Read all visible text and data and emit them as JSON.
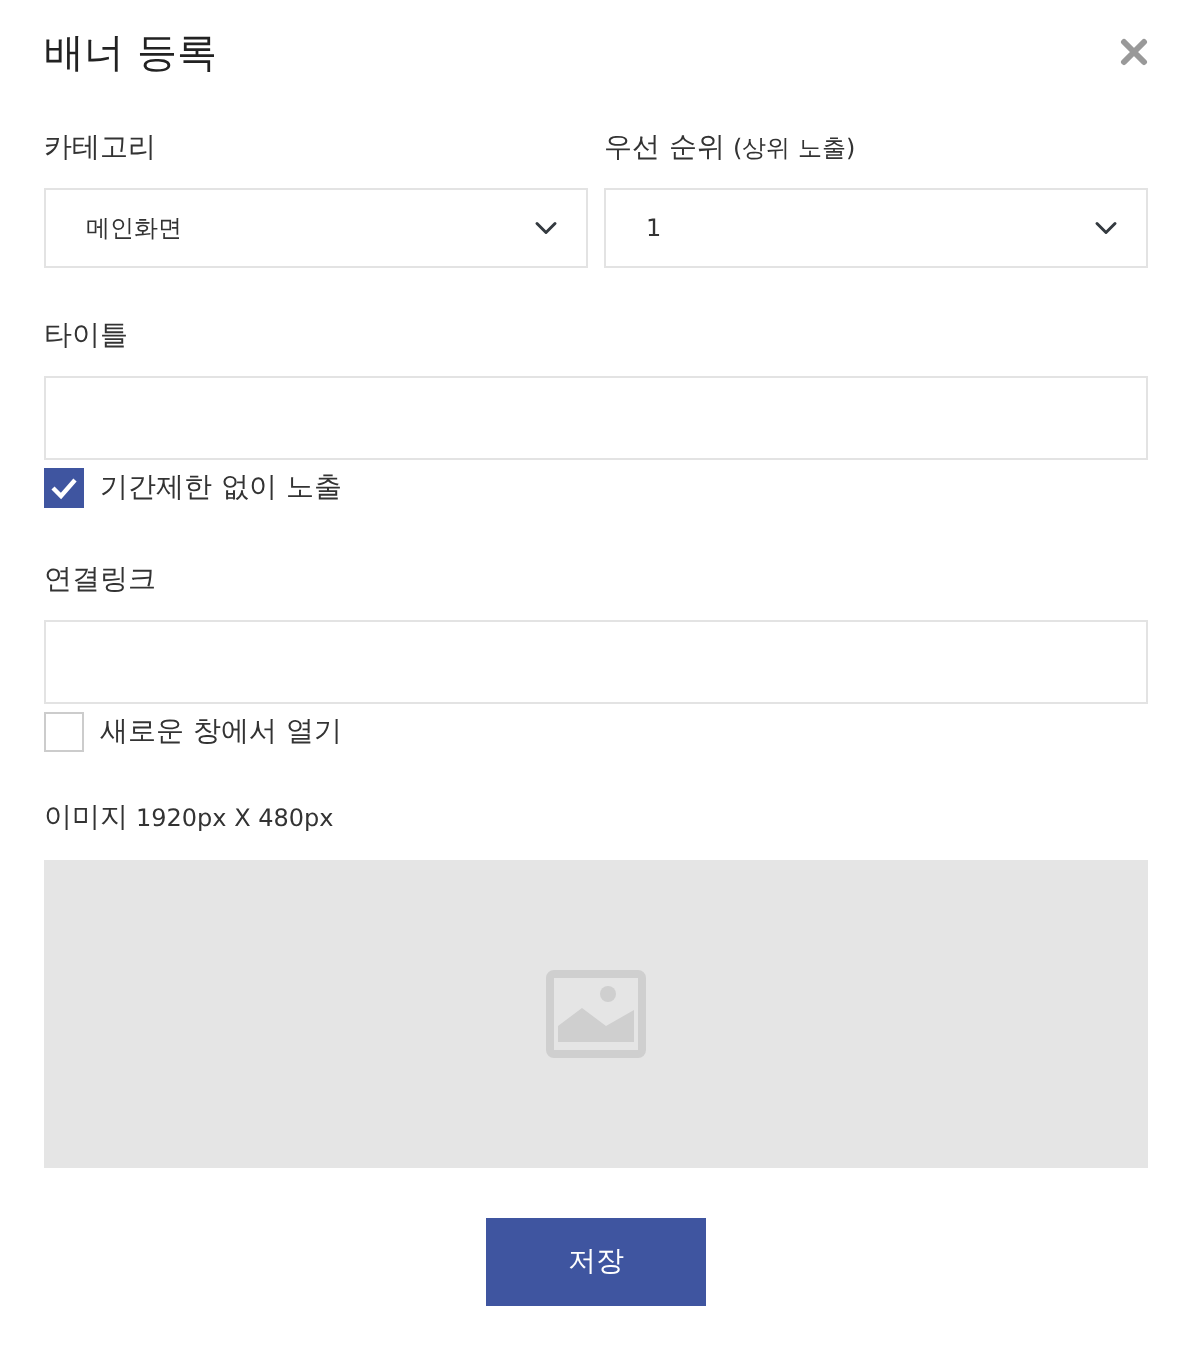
{
  "dialog": {
    "title": "배너 등록"
  },
  "category": {
    "label": "카테고리",
    "value": "메인화면"
  },
  "priority": {
    "label": "우선 순위",
    "note": "(상위 노출)",
    "value": "1"
  },
  "title_field": {
    "label": "타이틀"
  },
  "no_period_limit": {
    "label": "기간제한 없이 노출",
    "checked": true
  },
  "link_field": {
    "label": "연결링크"
  },
  "new_window": {
    "label": "새로운 창에서 열기",
    "checked": false
  },
  "image": {
    "label": "이미지",
    "size": "1920px X 480px"
  },
  "buttons": [
    "저장"
  ]
}
